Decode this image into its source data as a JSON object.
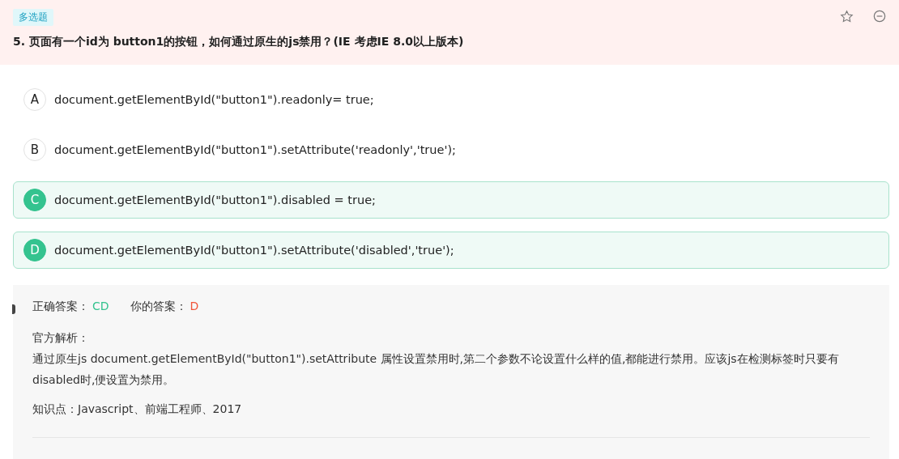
{
  "question": {
    "type_tag": "多选题",
    "title": "5. 页面有一个id为 button1的按钮，如何通过原生的js禁用？(IE 考虑IE 8.0以上版本)"
  },
  "options": [
    {
      "letter": "A",
      "text": "document.getElementById(\"button1\").readonly= true;",
      "selected": false
    },
    {
      "letter": "B",
      "text": "document.getElementById(\"button1\").setAttribute('readonly','true');",
      "selected": false
    },
    {
      "letter": "C",
      "text": "document.getElementById(\"button1\").disabled = true;",
      "selected": true
    },
    {
      "letter": "D",
      "text": "document.getElementById(\"button1\").setAttribute('disabled','true');",
      "selected": true
    }
  ],
  "answer": {
    "correct_label": "正确答案：",
    "correct_value": "CD",
    "yours_label": "你的答案：",
    "yours_value": "D",
    "analysis_title": "官方解析：",
    "analysis_text": "通过原生js document.getElementById(\"button1\").setAttribute 属性设置禁用时,第二个参数不论设置什么样的值,都能进行禁用。应该js在检测标签时只要有disabled时,便设置为禁用。",
    "knowledge": "知识点：Javascript、前端工程师、2017"
  }
}
